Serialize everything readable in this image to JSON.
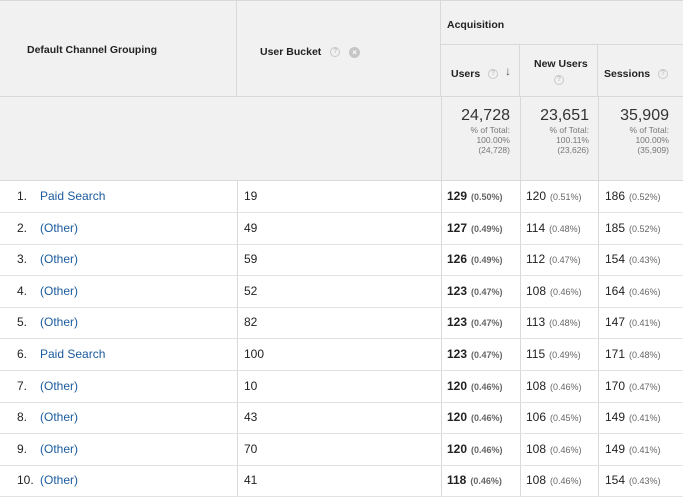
{
  "header": {
    "channel_label": "Default Channel Grouping",
    "bucket_label": "User Bucket",
    "acquisition_label": "Acquisition",
    "users_label": "Users",
    "new_users_label": "New Users",
    "sessions_label": "Sessions",
    "help_glyph": "?",
    "remove_glyph": "×",
    "sort_glyph": "↓"
  },
  "totals": {
    "users": {
      "value": "24,728",
      "l1": "% of Total:",
      "l2": "100.00%",
      "l3": "(24,728)"
    },
    "new_users": {
      "value": "23,651",
      "l1": "% of Total:",
      "l2": "100.11%",
      "l3": "(23,626)"
    },
    "sessions": {
      "value": "35,909",
      "l1": "% of Total:",
      "l2": "100.00%",
      "l3": "(35,909)"
    }
  },
  "rows": [
    {
      "idx": "1.",
      "channel": "Paid Search",
      "bucket": "19",
      "users": "129",
      "users_pct": "(0.50%)",
      "new_users": "120",
      "new_pct": "(0.51%)",
      "sessions": "186",
      "sess_pct": "(0.52%)"
    },
    {
      "idx": "2.",
      "channel": "(Other)",
      "bucket": "49",
      "users": "127",
      "users_pct": "(0.49%)",
      "new_users": "114",
      "new_pct": "(0.48%)",
      "sessions": "185",
      "sess_pct": "(0.52%)"
    },
    {
      "idx": "3.",
      "channel": "(Other)",
      "bucket": "59",
      "users": "126",
      "users_pct": "(0.49%)",
      "new_users": "112",
      "new_pct": "(0.47%)",
      "sessions": "154",
      "sess_pct": "(0.43%)"
    },
    {
      "idx": "4.",
      "channel": "(Other)",
      "bucket": "52",
      "users": "123",
      "users_pct": "(0.47%)",
      "new_users": "108",
      "new_pct": "(0.46%)",
      "sessions": "164",
      "sess_pct": "(0.46%)"
    },
    {
      "idx": "5.",
      "channel": "(Other)",
      "bucket": "82",
      "users": "123",
      "users_pct": "(0.47%)",
      "new_users": "113",
      "new_pct": "(0.48%)",
      "sessions": "147",
      "sess_pct": "(0.41%)"
    },
    {
      "idx": "6.",
      "channel": "Paid Search",
      "bucket": "100",
      "users": "123",
      "users_pct": "(0.47%)",
      "new_users": "115",
      "new_pct": "(0.49%)",
      "sessions": "171",
      "sess_pct": "(0.48%)"
    },
    {
      "idx": "7.",
      "channel": "(Other)",
      "bucket": "10",
      "users": "120",
      "users_pct": "(0.46%)",
      "new_users": "108",
      "new_pct": "(0.46%)",
      "sessions": "170",
      "sess_pct": "(0.47%)"
    },
    {
      "idx": "8.",
      "channel": "(Other)",
      "bucket": "43",
      "users": "120",
      "users_pct": "(0.46%)",
      "new_users": "106",
      "new_pct": "(0.45%)",
      "sessions": "149",
      "sess_pct": "(0.41%)"
    },
    {
      "idx": "9.",
      "channel": "(Other)",
      "bucket": "70",
      "users": "120",
      "users_pct": "(0.46%)",
      "new_users": "108",
      "new_pct": "(0.46%)",
      "sessions": "149",
      "sess_pct": "(0.41%)"
    },
    {
      "idx": "10.",
      "channel": "(Other)",
      "bucket": "41",
      "users": "118",
      "users_pct": "(0.46%)",
      "new_users": "108",
      "new_pct": "(0.46%)",
      "sessions": "154",
      "sess_pct": "(0.43%)"
    }
  ]
}
